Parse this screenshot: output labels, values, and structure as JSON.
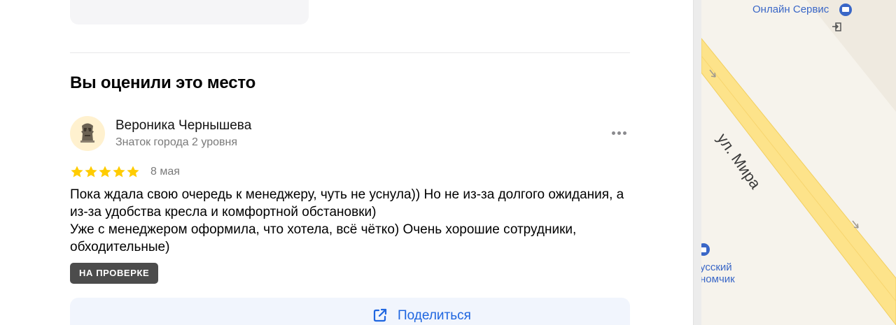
{
  "section": {
    "title": "Вы оценили это место"
  },
  "review": {
    "author_name": "Вероника Чернышева",
    "author_level": "Знаток города 2 уровня",
    "rating": 5,
    "rating_max": 5,
    "date": "8 мая",
    "text": "Пока ждала свою очередь к менеджеру, чуть не уснула)) Но не из-за долгого ожидания, а из-за удобства кресла и комфортной обстановки)\nУже с менеджером оформила, что хотела, всё чётко) Очень хорошие сотрудники, обходительные)",
    "status_badge": "НА ПРОВЕРКЕ",
    "more_icon": "more-horizontal-icon",
    "avatar_icon": "moai-statue-icon",
    "star_icon": "star-icon"
  },
  "share": {
    "label": "Поделиться",
    "icon": "share-external-icon"
  },
  "map": {
    "street": "ул. Мира",
    "pois": [
      {
        "name": "Онлайн Сервис",
        "icon": "shop-icon"
      },
      {
        "name": "усский\nномчик",
        "icon": "shopping-icon"
      }
    ]
  },
  "colors": {
    "star": "#fc0",
    "badge_bg": "#4c4c4c",
    "share_bg": "#f1f5fd",
    "share_text": "#1f66e0",
    "map_road": "#fde38a",
    "map_bg": "#f6f3ec",
    "poi_text": "#3a67c7"
  }
}
